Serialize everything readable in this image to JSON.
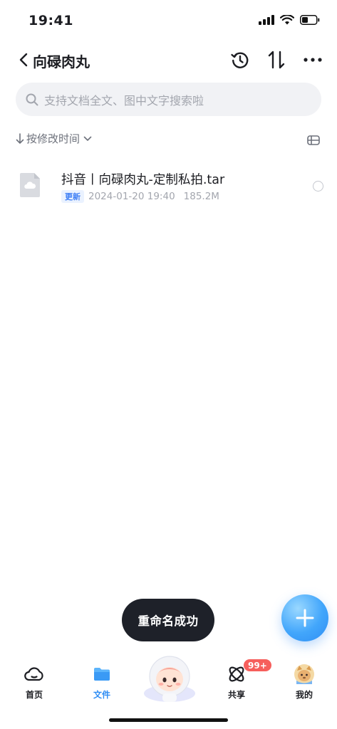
{
  "status_bar": {
    "time": "19:41"
  },
  "nav": {
    "title": "向碌肉丸"
  },
  "search": {
    "placeholder": "支持文档全文、图中文字搜索啦"
  },
  "sort": {
    "label": "按修改时间"
  },
  "files": [
    {
      "name": "抖音丨向碌肉丸-定制私拍.tar",
      "badge": "更新",
      "modified": "2024-01-20 19:40",
      "size": "185.2M"
    }
  ],
  "toast": {
    "text": "重命名成功"
  },
  "tabs": [
    {
      "label": "首页",
      "icon": "cloud-home-icon",
      "active": false
    },
    {
      "label": "文件",
      "icon": "folder-icon",
      "active": true
    },
    {
      "label": "共享",
      "icon": "share-orbit-icon",
      "active": false,
      "badge": "99+"
    },
    {
      "label": "我的",
      "icon": "profile-avatar-icon",
      "active": false
    }
  ],
  "colors": {
    "accent": "#2f8df4",
    "badge_red": "#f65f5c",
    "toast_bg": "#1e2129",
    "search_bg": "#f1f2f5"
  }
}
